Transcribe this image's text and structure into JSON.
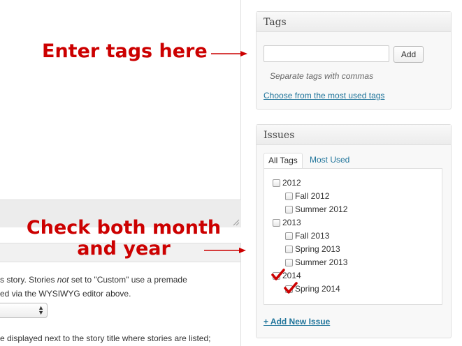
{
  "annotations": {
    "tags": "Enter tags here",
    "issues_line1": "Check both month",
    "issues_line2": "and year"
  },
  "left_panel": {
    "line1_a": "s story. Stories ",
    "line1_em": "not",
    "line1_b": " set to \"Custom\" use a premade",
    "line2": "ed via the WYSIWYG editor above.",
    "line3": "e displayed next to the story title where stories are listed;"
  },
  "tags_box": {
    "title": "Tags",
    "input_value": "",
    "add_label": "Add",
    "howto": "Separate tags with commas",
    "most_used_link": "Choose from the most used tags"
  },
  "issues_box": {
    "title": "Issues",
    "tabs": [
      {
        "label": "All Tags",
        "active": true
      },
      {
        "label": "Most Used",
        "active": false
      }
    ],
    "items": [
      {
        "label": "2012",
        "checked": false
      },
      {
        "label": "Fall 2012",
        "checked": false
      },
      {
        "label": "Summer 2012",
        "checked": false
      },
      {
        "label": "2013",
        "checked": false
      },
      {
        "label": "Fall 2013",
        "checked": false
      },
      {
        "label": "Spring 2013",
        "checked": false
      },
      {
        "label": "Summer 2013",
        "checked": false
      },
      {
        "label": "2014",
        "checked": true
      },
      {
        "label": "Spring 2014",
        "checked": true
      }
    ],
    "add_new_link": "+ Add New Issue"
  },
  "colors": {
    "annotation": "#cc0000",
    "link": "#21759b"
  }
}
